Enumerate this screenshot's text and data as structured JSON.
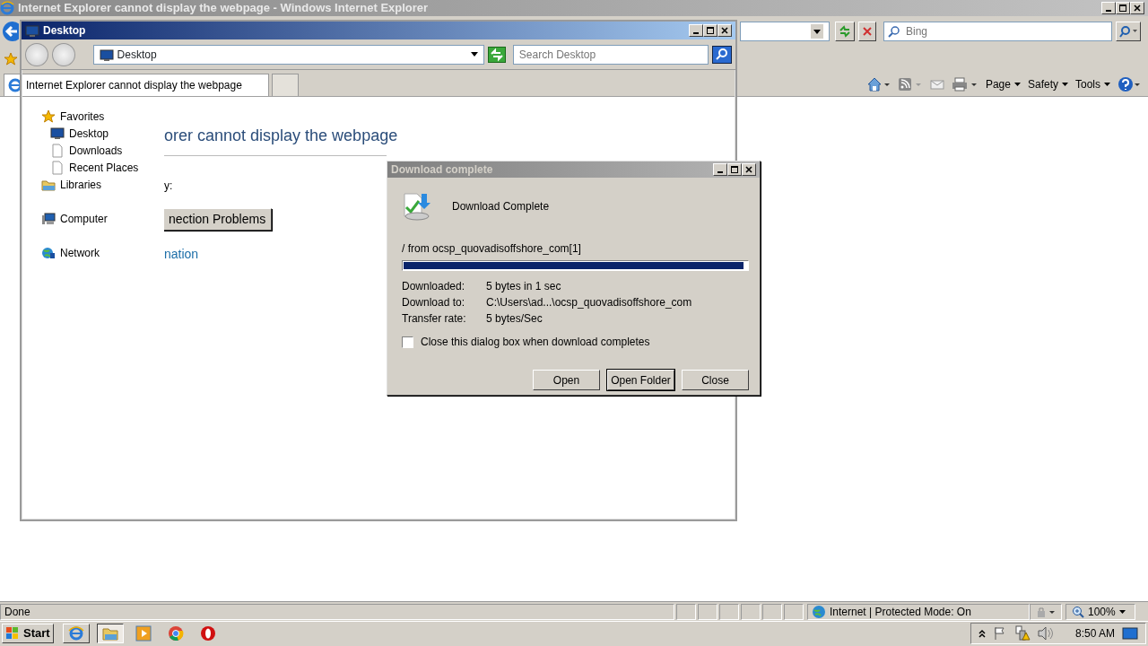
{
  "ie": {
    "title": "Internet Explorer cannot display the webpage - Windows Internet Explorer",
    "search_placeholder": "Bing",
    "tab": "Internet Explorer cannot display the webpage",
    "commands": [
      "Page",
      "Safety",
      "Tools"
    ],
    "page": {
      "heading": "orer cannot display the webpage",
      "line": "y:",
      "button": "nection Problems",
      "link": "nation"
    },
    "status": {
      "text": "Done",
      "zone": "Internet | Protected Mode: On",
      "zoom": "100%"
    }
  },
  "explorer": {
    "title": "Desktop",
    "address": "Desktop",
    "search_placeholder": "Search Desktop",
    "nav": [
      {
        "label": "Favorites",
        "kind": "star",
        "children": [
          {
            "label": "Desktop",
            "kind": "monitor"
          },
          {
            "label": "Downloads",
            "kind": "page"
          },
          {
            "label": "Recent Places",
            "kind": "page"
          }
        ]
      },
      {
        "label": "Libraries",
        "kind": "folder"
      },
      {
        "label": "Computer",
        "kind": "computer"
      },
      {
        "label": "Network",
        "kind": "globe"
      }
    ]
  },
  "dialog": {
    "title": "Download complete",
    "heading": "Download Complete",
    "source": "/ from ocsp_quovadisoffshore_com[1]",
    "level": 0.99,
    "details": [
      {
        "label": "Downloaded:",
        "value": "5 bytes in 1 sec"
      },
      {
        "label": "Download to:",
        "value": "C:\\Users\\ad...\\ocsp_quovadisoffshore_com"
      },
      {
        "label": "Transfer rate:",
        "value": "5 bytes/Sec"
      }
    ],
    "checkbox": {
      "label": "Close this dialog box when download completes",
      "checked": false
    },
    "buttons": [
      {
        "label": "Open",
        "default": false
      },
      {
        "label": "Open Folder",
        "default": true
      },
      {
        "label": "Close",
        "default": false
      }
    ]
  },
  "taskbar": {
    "start": "Start",
    "apps": [
      {
        "kind": "ie",
        "selected": false
      },
      {
        "kind": "folder",
        "selected": true
      },
      {
        "kind": "media",
        "selected": false
      },
      {
        "kind": "chrome",
        "selected": false
      },
      {
        "kind": "opera",
        "selected": false
      }
    ],
    "clock": "8:50 AM"
  }
}
